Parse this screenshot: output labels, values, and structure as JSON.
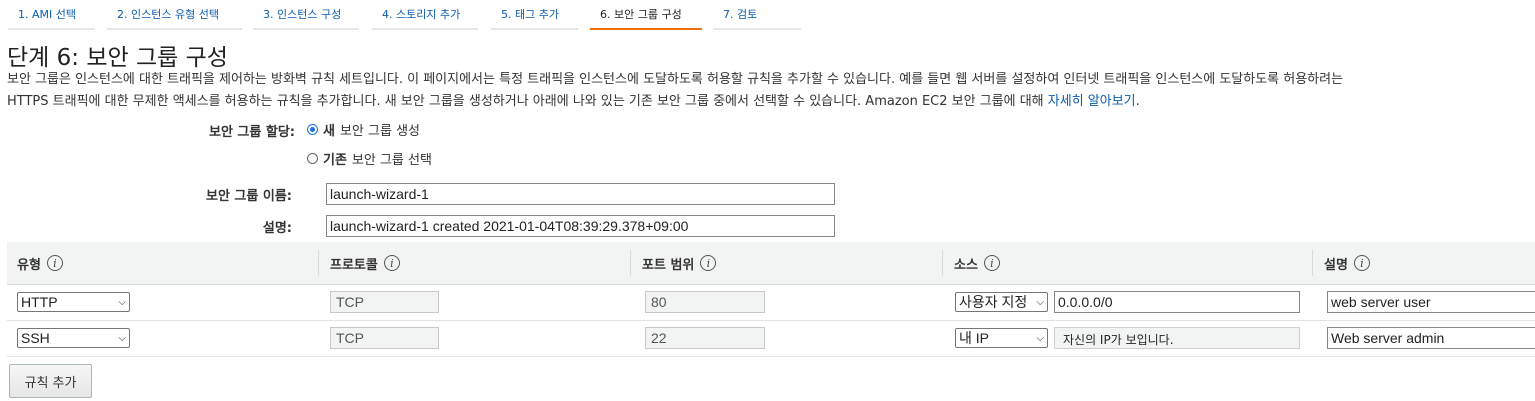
{
  "wizard": {
    "steps": [
      {
        "label": "1. AMI 선택"
      },
      {
        "label": "2. 인스턴스 유형 선택"
      },
      {
        "label": "3. 인스턴스 구성"
      },
      {
        "label": "4. 스토리지 추가"
      },
      {
        "label": "5. 태그 추가"
      },
      {
        "label": "6. 보안 그룹 구성"
      },
      {
        "label": "7. 검토"
      }
    ],
    "active_step": 6
  },
  "page": {
    "title": "단계 6: 보안 그룹 구성",
    "intro_line1": "보안 그룹은 인스턴스에 대한 트래픽을 제어하는 방화벽 규칙 세트입니다. 이 페이지에서는 특정 트래픽을 인스턴스에 도달하도록 허용할 규칙을 추가할 수 있습니다. 예를 들면 웹 서버를 설정하여 인터넷 트래픽을 인스턴스에 도달하도록 허용하려는",
    "intro_line2": "HTTPS 트래픽에 대한 무제한 액세스를 허용하는 규칙을 추가합니다. 새 보안 그룹을 생성하거나 아래에 나와 있는 기존 보안 그룹 중에서 선택할 수 있습니다. Amazon EC2 보안 그룹에 대해 ",
    "learn_more": "자세히 알아보기",
    "period": "."
  },
  "form": {
    "assign_label": "보안 그룹 할당:",
    "option_new_bold": "새",
    "option_new_rest": "보안 그룹 생성",
    "option_existing_bold": "기존",
    "option_existing_rest": "보안 그룹 선택",
    "selected_option": "new",
    "name_label": "보안 그룹 이름:",
    "name_value": "launch-wizard-1",
    "desc_label": "설명:",
    "desc_value": "launch-wizard-1 created 2021-01-04T08:39:29.378+09:00"
  },
  "rules_table": {
    "columns": [
      "유형",
      "프로토콜",
      "포트 범위",
      "소스",
      "설명"
    ],
    "info_glyph": "i",
    "rows": [
      {
        "type": "HTTP",
        "protocol": "TCP",
        "port": "80",
        "source": "사용자 지정",
        "cidr": "0.0.0.0/0",
        "description": "web server user"
      },
      {
        "type": "SSH",
        "protocol": "TCP",
        "port": "22",
        "source": "내 IP",
        "cidr": "자신의 IP가 보입니다.",
        "description": "Web server admin"
      }
    ],
    "add_rule_label": "규칙 추가"
  },
  "colors": {
    "link": "#0b5cad",
    "active_tab_underline": "#ec7211",
    "header_bg": "#f2f3f3",
    "radio_checked": "#1a73e8"
  },
  "icons": {
    "info": "info-icon",
    "select_arrow": "chevron-down-icon"
  }
}
